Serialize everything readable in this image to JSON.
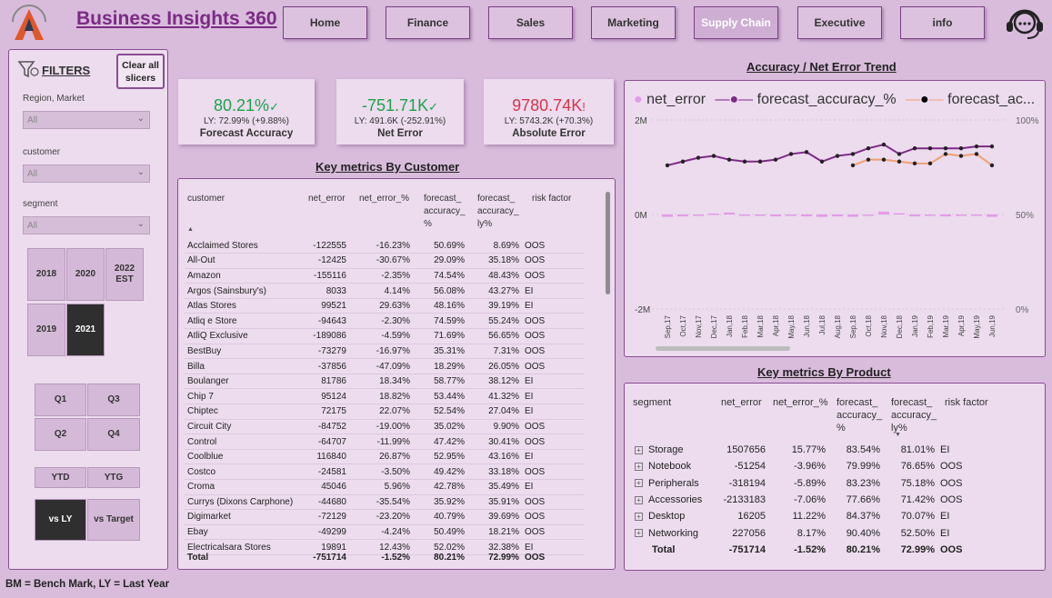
{
  "header": {
    "title": "Business Insights 360",
    "nav": [
      "Home",
      "Finance",
      "Sales",
      "Marketing",
      "Supply Chain",
      "Executive",
      "info"
    ],
    "active_nav": "Supply Chain"
  },
  "filters": {
    "title": "FILTERS",
    "clear_label": "Clear all slicers",
    "region_label": "Region, Market",
    "region_value": "All",
    "customer_label": "customer",
    "customer_value": "All",
    "segment_label": "segment",
    "segment_value": "All",
    "years": [
      "2018",
      "2020",
      "2022 EST",
      "2019",
      "2021"
    ],
    "selected_year": "2021",
    "quarters": [
      "Q1",
      "Q3",
      "Q2",
      "Q4"
    ],
    "ytd": "YTD",
    "ytg": "YTG",
    "vs_ly": "vs LY",
    "vs_target": "vs Target"
  },
  "kpis": [
    {
      "value": "80.21%",
      "mark": "✓",
      "ly": "LY: 72.99% (+9.88%)",
      "label": "Forecast Accuracy",
      "color": "#1aa34a"
    },
    {
      "value": "-751.71K",
      "mark": "✓",
      "ly": "LY: 491.6K (-252.91%)",
      "label": "Net Error",
      "color": "#1aa34a"
    },
    {
      "value": "9780.74K",
      "mark": "!",
      "ly": "LY: 5743.2K (+70.3%)",
      "label": "Absolute Error",
      "color": "#d9344a"
    }
  ],
  "customer_table": {
    "title": "Key metrics By Customer",
    "headers": [
      "customer",
      "net_error",
      "net_error_%",
      "forecast_ accuracy_ %",
      "forecast_ accuracy_ ly%",
      "risk factor"
    ],
    "rows": [
      [
        "Acclaimed Stores",
        "-122555",
        "-16.23%",
        "50.69%",
        "8.69%",
        "OOS"
      ],
      [
        "All-Out",
        "-12425",
        "-30.67%",
        "29.09%",
        "35.18%",
        "OOS"
      ],
      [
        "Amazon",
        "-155116",
        "-2.35%",
        "74.54%",
        "48.43%",
        "OOS"
      ],
      [
        "Argos (Sainsbury's)",
        "8033",
        "4.14%",
        "56.08%",
        "43.27%",
        "EI"
      ],
      [
        "Atlas Stores",
        "99521",
        "29.63%",
        "48.16%",
        "39.19%",
        "EI"
      ],
      [
        "Atliq e Store",
        "-94643",
        "-2.30%",
        "74.59%",
        "55.24%",
        "OOS"
      ],
      [
        "AtliQ Exclusive",
        "-189086",
        "-4.59%",
        "71.69%",
        "56.65%",
        "OOS"
      ],
      [
        "BestBuy",
        "-73279",
        "-16.97%",
        "35.31%",
        "7.31%",
        "OOS"
      ],
      [
        "Billa",
        "-37856",
        "-47.09%",
        "18.29%",
        "26.05%",
        "OOS"
      ],
      [
        "Boulanger",
        "81786",
        "18.34%",
        "58.77%",
        "38.12%",
        "EI"
      ],
      [
        "Chip 7",
        "95124",
        "18.82%",
        "53.44%",
        "41.32%",
        "EI"
      ],
      [
        "Chiptec",
        "72175",
        "22.07%",
        "52.54%",
        "27.04%",
        "EI"
      ],
      [
        "Circuit City",
        "-84752",
        "-19.00%",
        "35.02%",
        "9.90%",
        "OOS"
      ],
      [
        "Control",
        "-64707",
        "-11.99%",
        "47.42%",
        "30.41%",
        "OOS"
      ],
      [
        "Coolblue",
        "116840",
        "26.87%",
        "52.95%",
        "43.16%",
        "EI"
      ],
      [
        "Costco",
        "-24581",
        "-3.50%",
        "49.42%",
        "33.18%",
        "OOS"
      ],
      [
        "Croma",
        "45046",
        "5.96%",
        "42.78%",
        "35.49%",
        "EI"
      ],
      [
        "Currys (Dixons Carphone)",
        "-44680",
        "-35.54%",
        "35.92%",
        "35.91%",
        "OOS"
      ],
      [
        "Digimarket",
        "-72129",
        "-23.20%",
        "40.79%",
        "39.69%",
        "OOS"
      ],
      [
        "Ebay",
        "-49299",
        "-4.24%",
        "50.49%",
        "18.21%",
        "OOS"
      ],
      [
        "Electricalsara Stores",
        "19891",
        "12.43%",
        "52.02%",
        "32.38%",
        "EI"
      ]
    ],
    "total": [
      "Total",
      "-751714",
      "-1.52%",
      "80.21%",
      "72.99%",
      "OOS"
    ]
  },
  "trend": {
    "title": "Accuracy / Net Error Trend",
    "legend": [
      "net_error",
      "forecast_accuracy_%",
      "forecast_ac..."
    ],
    "left_ticks": [
      "2M",
      "0M",
      "-2M"
    ],
    "right_ticks": [
      "100%",
      "50%",
      "0%"
    ],
    "colors": {
      "net_error": "#e39be9",
      "accuracy": "#7d2a87",
      "accuracy_ly": "#f0a070"
    }
  },
  "chart_data": {
    "type": "line",
    "title": "Accuracy / Net Error Trend",
    "x": [
      "Sep,17",
      "Oct,17",
      "Nov,17",
      "Dec,17",
      "Jan,18",
      "Feb,18",
      "Mar,18",
      "Apr,18",
      "May,18",
      "Jun,18",
      "Jul,18",
      "Aug,18",
      "Sep,18",
      "Oct,18",
      "Nov,18",
      "Dec,18",
      "Jan,19",
      "Feb,19",
      "Mar,19",
      "Apr,19",
      "May,19",
      "Jun,19"
    ],
    "series": [
      {
        "name": "net_error",
        "type": "bar",
        "axis": "left",
        "values": [
          -0.05,
          -0.04,
          -0.03,
          0.02,
          0.04,
          -0.02,
          -0.03,
          -0.04,
          -0.03,
          -0.04,
          -0.05,
          -0.04,
          -0.05,
          -0.02,
          0.06,
          0.03,
          -0.04,
          -0.03,
          -0.04,
          -0.03,
          -0.02,
          -0.05
        ]
      },
      {
        "name": "forecast_accuracy_%",
        "type": "line",
        "axis": "right",
        "values": [
          76,
          78,
          80,
          81,
          79,
          78,
          78,
          79,
          82,
          83,
          78,
          81,
          82,
          85,
          87,
          82,
          85,
          85,
          85,
          85,
          86,
          86
        ]
      },
      {
        "name": "forecast_ac...",
        "type": "line",
        "axis": "right",
        "values": [
          null,
          null,
          null,
          null,
          null,
          null,
          null,
          null,
          null,
          null,
          null,
          null,
          76,
          79,
          79,
          78,
          77,
          77,
          82,
          81,
          82,
          76
        ]
      }
    ],
    "ylim_left": [
      -2,
      2
    ],
    "ylim_right": [
      0,
      100
    ]
  },
  "product_table": {
    "title": "Key metrics By Product",
    "headers": [
      "segment",
      "net_error",
      "net_error_%",
      "forecast_ accuracy_ %",
      "forecast_ accuracy_ ly%",
      "risk factor"
    ],
    "rows": [
      [
        "Storage",
        "1507656",
        "15.77%",
        "83.54%",
        "81.01%",
        "EI"
      ],
      [
        "Notebook",
        "-51254",
        "-3.96%",
        "79.99%",
        "76.65%",
        "OOS"
      ],
      [
        "Peripherals",
        "-318194",
        "-5.89%",
        "83.23%",
        "75.18%",
        "OOS"
      ],
      [
        "Accessories",
        "-2133183",
        "-7.06%",
        "77.66%",
        "71.42%",
        "OOS"
      ],
      [
        "Desktop",
        "16205",
        "11.22%",
        "84.37%",
        "70.07%",
        "EI"
      ],
      [
        "Networking",
        "227056",
        "8.17%",
        "90.40%",
        "52.50%",
        "EI"
      ]
    ],
    "total": [
      "Total",
      "-751714",
      "-1.52%",
      "80.21%",
      "72.99%",
      "OOS"
    ]
  },
  "footer": "BM = Bench Mark,  LY = Last Year"
}
